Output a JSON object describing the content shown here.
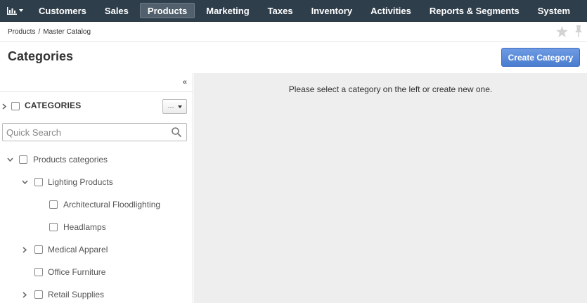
{
  "nav": {
    "logo_icon": "bar-chart-icon",
    "items": [
      {
        "label": "Customers"
      },
      {
        "label": "Sales"
      },
      {
        "label": "Products",
        "active": true
      },
      {
        "label": "Marketing"
      },
      {
        "label": "Taxes"
      },
      {
        "label": "Inventory"
      },
      {
        "label": "Activities"
      },
      {
        "label": "Reports & Segments"
      },
      {
        "label": "System"
      }
    ]
  },
  "breadcrumb": {
    "items": [
      "Products",
      "Master Catalog"
    ],
    "separator": "/"
  },
  "page": {
    "title": "Categories",
    "create_button": "Create Category"
  },
  "sidebar": {
    "collapse_glyph": "«",
    "header_label": "CATEGORIES",
    "actions_glyph": "···",
    "search_placeholder": "Quick Search",
    "tree": [
      {
        "label": "Products categories",
        "expanded": true,
        "has_children": true,
        "level": 0
      },
      {
        "label": "Lighting Products",
        "expanded": true,
        "has_children": true,
        "level": 1
      },
      {
        "label": "Architectural Floodlighting",
        "has_children": false,
        "level": 2
      },
      {
        "label": "Headlamps",
        "has_children": false,
        "level": 2
      },
      {
        "label": "Medical Apparel",
        "expanded": false,
        "has_children": true,
        "level": 1
      },
      {
        "label": "Office Furniture",
        "has_children": false,
        "level": 1
      },
      {
        "label": "Retail Supplies",
        "expanded": false,
        "has_children": true,
        "level": 1
      }
    ]
  },
  "main": {
    "empty_message": "Please select a category on the left or create new one."
  },
  "colors": {
    "nav_bg": "#2f3e4b",
    "primary_button": "#5b8bd9",
    "content_bg": "#eeeeee"
  }
}
